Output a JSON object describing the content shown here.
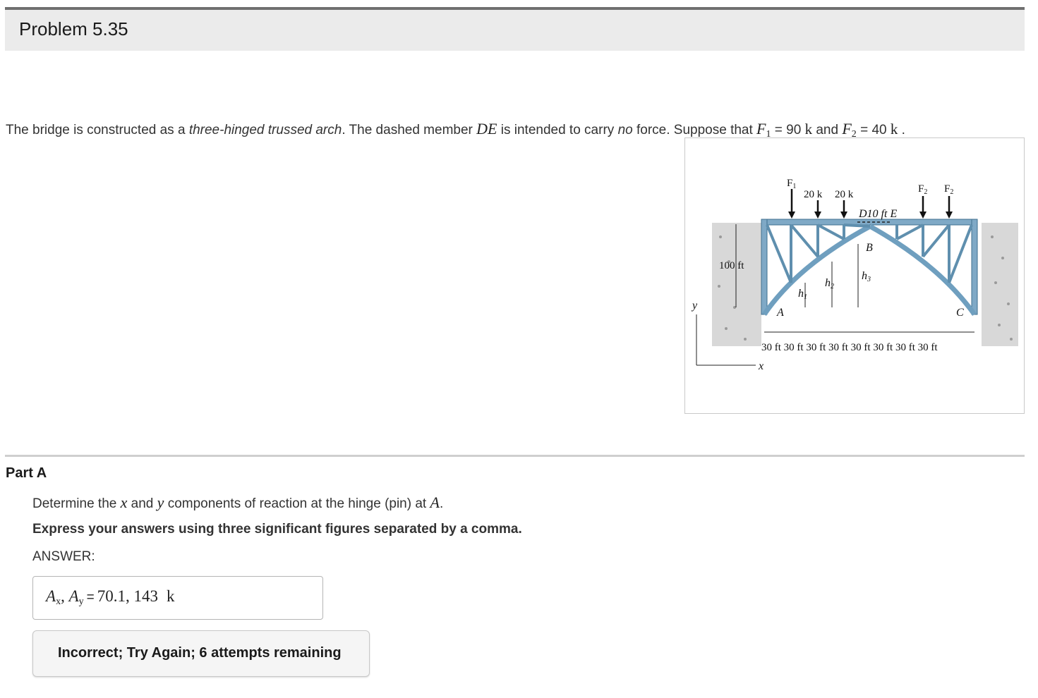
{
  "header": {
    "title": "Problem 5.35"
  },
  "problem": {
    "text_1": "The bridge is constructed as a ",
    "text_italic_1": "three-hinged trussed arch",
    "text_2": ". The dashed member ",
    "member": "DE",
    "text_3": " is intended to carry ",
    "text_italic_2": "no",
    "text_4": " force. Suppose that ",
    "f1_symbol": "F",
    "f1_sub": "1",
    "f1_value": " = 90 ",
    "unit": "k",
    "and": " and ",
    "f2_symbol": "F",
    "f2_sub": "2",
    "f2_value": " = 40 ",
    "end": " ."
  },
  "figure": {
    "load_f1": "F",
    "load_f1_sub": "1",
    "load_20k_a": "20 k",
    "load_20k_b": "20 k",
    "load_f2_a": "F",
    "load_f2_a_sub": "2",
    "load_f2_b": "F",
    "load_f2_b_sub": "2",
    "label_d10ft_e": "D10 ft E",
    "label_b": "B",
    "label_a": "A",
    "label_c": "C",
    "label_100ft": "100 ft",
    "label_h1": "h",
    "label_h1_sub": "1",
    "label_h2": "h",
    "label_h2_sub": "2",
    "label_h3": "h",
    "label_h3_sub": "3",
    "axis_y": "y",
    "axis_x": "x",
    "spans": "30 ft 30 ft  30 ft 30 ft 30 ft  30 ft 30 ft  30 ft"
  },
  "part": {
    "label": "Part A",
    "question_1": "Determine the ",
    "question_x": "x",
    "question_2": " and ",
    "question_y": "y",
    "question_3": " components of reaction at the hinge (pin) at ",
    "question_a": "A",
    "question_4": ".",
    "instruction": "Express your answers using three significant figures separated by a comma.",
    "answer_label": "ANSWER:"
  },
  "answer": {
    "lhs_1": "A",
    "lhs_1_sub": "x",
    "comma": ", ",
    "lhs_2": "A",
    "lhs_2_sub": "y",
    "equals": "=",
    "value": "70.1, 143",
    "unit": "k"
  },
  "feedback": {
    "message": "Incorrect; Try Again; 6 attempts remaining"
  },
  "colors": {
    "header_bg": "#ebebeb",
    "header_border": "#6f6f6f",
    "truss": "#6f9fbf",
    "divider": "#cfcfcf"
  }
}
